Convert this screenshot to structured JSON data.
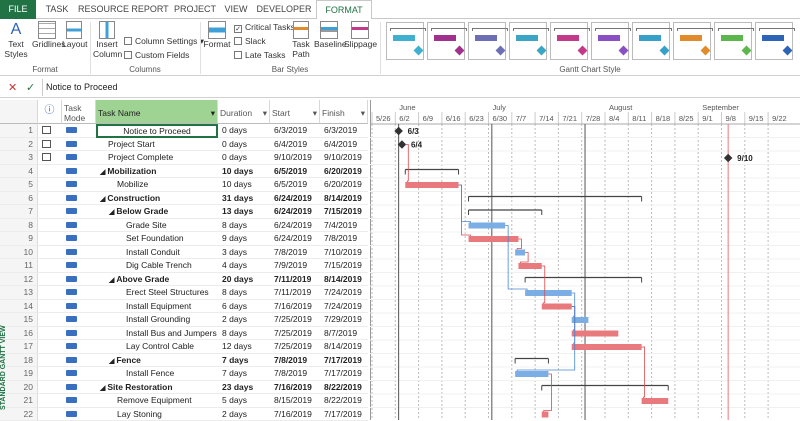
{
  "tabs": [
    "FILE",
    "TASK",
    "RESOURCE",
    "REPORT",
    "PROJECT",
    "VIEW",
    "DEVELOPER",
    "FORMAT"
  ],
  "ribbon": {
    "format_group": {
      "text_styles": "Text\nStyles",
      "gridlines": "Gridlines",
      "layout": "Layout",
      "label": "Format"
    },
    "columns_group": {
      "insert_column": "Insert\nColumn",
      "column_settings": "Column Settings",
      "custom_fields": "Custom Fields",
      "label": "Columns"
    },
    "bar_styles_group": {
      "format": "Format",
      "critical_tasks": "Critical Tasks",
      "slack": "Slack",
      "late_tasks": "Late Tasks",
      "task_path": "Task\nPath",
      "baseline": "Baseline",
      "slippage": "Slippage",
      "label": "Bar Styles"
    },
    "gantt_style_label": "Gantt Chart Style",
    "style_colors": [
      "#3fb0d0",
      "#a0318c",
      "#6d6fb5",
      "#3aa6c4",
      "#c43a8a",
      "#8a4fc2",
      "#36a0c8",
      "#e08b2c",
      "#5bb64b",
      "#2d64b5"
    ]
  },
  "formula_bar": {
    "cancel": "✕",
    "enter": "✓",
    "value": "Notice to Proceed"
  },
  "grid": {
    "headers": {
      "indicator": "ⓘ",
      "mode": "Task\nMode",
      "name": "Task Name",
      "duration": "Duration",
      "start": "Start",
      "finish": "Finish"
    },
    "rows": [
      {
        "id": "1",
        "name": "Notice to Proceed",
        "indent": 0,
        "summary": false,
        "duration": "0 days",
        "start": "6/3/2019",
        "finish": "6/3/2019"
      },
      {
        "id": "2",
        "name": "Project Start",
        "indent": 0,
        "summary": false,
        "duration": "0 days",
        "start": "6/4/2019",
        "finish": "6/4/2019"
      },
      {
        "id": "3",
        "name": "Project Complete",
        "indent": 0,
        "summary": false,
        "duration": "0 days",
        "start": "9/10/2019",
        "finish": "9/10/2019"
      },
      {
        "id": "4",
        "name": "Mobilization",
        "indent": 0,
        "summary": true,
        "duration": "10 days",
        "start": "6/5/2019",
        "finish": "6/20/2019"
      },
      {
        "id": "5",
        "name": "Mobilize",
        "indent": 1,
        "summary": false,
        "duration": "10 days",
        "start": "6/5/2019",
        "finish": "6/20/2019"
      },
      {
        "id": "6",
        "name": "Construction",
        "indent": 0,
        "summary": true,
        "duration": "31 days",
        "start": "6/24/2019",
        "finish": "8/14/2019"
      },
      {
        "id": "7",
        "name": "Below Grade",
        "indent": 1,
        "summary": true,
        "duration": "13 days",
        "start": "6/24/2019",
        "finish": "7/15/2019"
      },
      {
        "id": "8",
        "name": "Grade Site",
        "indent": 2,
        "summary": false,
        "duration": "8 days",
        "start": "6/24/2019",
        "finish": "7/4/2019"
      },
      {
        "id": "9",
        "name": "Set Foundation",
        "indent": 2,
        "summary": false,
        "duration": "9 days",
        "start": "6/24/2019",
        "finish": "7/8/2019"
      },
      {
        "id": "10",
        "name": "Install Conduit",
        "indent": 2,
        "summary": false,
        "duration": "3 days",
        "start": "7/8/2019",
        "finish": "7/10/2019"
      },
      {
        "id": "11",
        "name": "Dig Cable Trench",
        "indent": 2,
        "summary": false,
        "duration": "4 days",
        "start": "7/9/2019",
        "finish": "7/15/2019"
      },
      {
        "id": "12",
        "name": "Above Grade",
        "indent": 1,
        "summary": true,
        "duration": "20 days",
        "start": "7/11/2019",
        "finish": "8/14/2019"
      },
      {
        "id": "13",
        "name": "Erect Steel Structures",
        "indent": 2,
        "summary": false,
        "duration": "8 days",
        "start": "7/11/2019",
        "finish": "7/24/2019"
      },
      {
        "id": "14",
        "name": "Install Equipment",
        "indent": 2,
        "summary": false,
        "duration": "6 days",
        "start": "7/16/2019",
        "finish": "7/24/2019"
      },
      {
        "id": "15",
        "name": "Install Grounding",
        "indent": 2,
        "summary": false,
        "duration": "2 days",
        "start": "7/25/2019",
        "finish": "7/29/2019"
      },
      {
        "id": "16",
        "name": "Install Bus and Jumpers",
        "indent": 2,
        "summary": false,
        "duration": "8 days",
        "start": "7/25/2019",
        "finish": "8/7/2019"
      },
      {
        "id": "17",
        "name": "Lay Control Cable",
        "indent": 2,
        "summary": false,
        "duration": "12 days",
        "start": "7/25/2019",
        "finish": "8/14/2019"
      },
      {
        "id": "18",
        "name": "Fence",
        "indent": 1,
        "summary": true,
        "duration": "7 days",
        "start": "7/8/2019",
        "finish": "7/17/2019"
      },
      {
        "id": "19",
        "name": "Install Fence",
        "indent": 2,
        "summary": false,
        "duration": "7 days",
        "start": "7/8/2019",
        "finish": "7/17/2019"
      },
      {
        "id": "20",
        "name": "Site Restoration",
        "indent": 0,
        "summary": true,
        "duration": "23 days",
        "start": "7/16/2019",
        "finish": "8/22/2019"
      },
      {
        "id": "21",
        "name": "Remove Equipment",
        "indent": 1,
        "summary": false,
        "duration": "5 days",
        "start": "8/15/2019",
        "finish": "8/22/2019"
      },
      {
        "id": "22",
        "name": "Lay Stoning",
        "indent": 1,
        "summary": false,
        "duration": "2 days",
        "start": "7/16/2019",
        "finish": "7/17/2019"
      }
    ]
  },
  "timeline": {
    "months": [
      {
        "label": "June",
        "week": 1
      },
      {
        "label": "July",
        "week": 5
      },
      {
        "label": "August",
        "week": 10
      },
      {
        "label": "September",
        "week": 14
      }
    ],
    "weeks": [
      "5/26",
      "6/2",
      "6/9",
      "6/16",
      "6/23",
      "6/30",
      "7/7",
      "7/14",
      "7/21",
      "7/28",
      "8/4",
      "8/11",
      "8/18",
      "8/25",
      "9/1",
      "9/8",
      "9/15",
      "9/22"
    ],
    "milestone_labels": [
      "6/3",
      "6/4",
      "9/10"
    ]
  },
  "side_label": "STANDARD GANTT VIEW",
  "colors": {
    "accent": "#217346",
    "critical": "#e8797c",
    "normal": "#7aaee4",
    "summary": "#444444"
  }
}
